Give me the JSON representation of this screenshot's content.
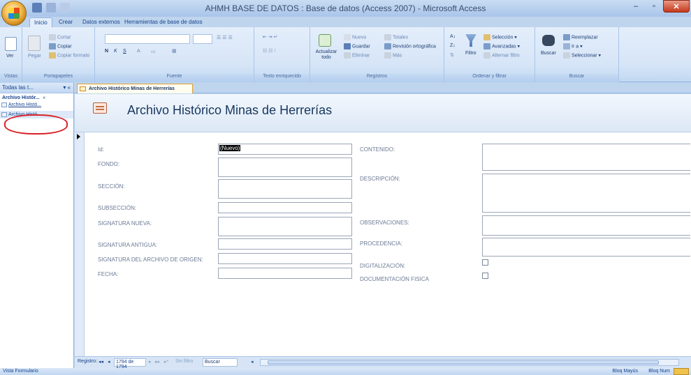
{
  "window": {
    "title": "AHMH BASE DE DATOS : Base de datos (Access 2007) - Microsoft Access",
    "min": "–",
    "max": "▫",
    "close": "✕"
  },
  "ribbon_tabs": [
    "Inicio",
    "Crear",
    "Datos externos",
    "Herramientas de base de datos"
  ],
  "ribbon": {
    "views": {
      "label": "Vistas",
      "ver": "Ver"
    },
    "clipboard": {
      "label": "Portapapeles",
      "pegar": "Pegar",
      "cortar": "Cortar",
      "copiar": "Copiar",
      "copiar_formato": "Copiar formato"
    },
    "font": {
      "label": "Fuente",
      "bold": "N",
      "italic": "K",
      "underline": "S",
      "color": "A"
    },
    "rich_text": {
      "label": "Texto enriquecido"
    },
    "records": {
      "label": "Registros",
      "actualizar": "Actualizar todo",
      "nuevo": "Nuevo",
      "guardar": "Guardar",
      "eliminar": "Eliminar",
      "totales": "Totales",
      "revision": "Revisión ortográfica",
      "mas": "Más"
    },
    "sort": {
      "label": "Ordenar y filtrar",
      "filtro": "Filtro",
      "seleccion": "Selección",
      "avanzadas": "Avanzadas",
      "alternar": "Alternar filtro"
    },
    "find": {
      "label": "Buscar",
      "buscar": "Buscar",
      "reemplazar": "Reemplazar",
      "ir_a": "Ir a",
      "seleccionar": "Seleccionar"
    }
  },
  "nav": {
    "header": "Todas las t...",
    "header_controls": "▾ «",
    "group": "Archivo Histór...",
    "group_control": "«",
    "items": [
      "Archivo Histó...",
      "Archivo Histó..."
    ]
  },
  "doc_tab": "Archivo Histórico Minas de Herrerías",
  "form": {
    "title": "Archivo Histórico Minas de Herrerías",
    "id_value": "(Nuevo)",
    "labels_left": {
      "id": "Id:",
      "fondo": "FONDO:",
      "seccion": "SECCIÓN:",
      "subseccion": "SUBSECCIÓN:",
      "signatura_nueva": "SIGNATURA NUEVA:",
      "signatura_antigua": "SIGNATURA ANTIGUA:",
      "signatura_origen": "SIGNATURA DEL ARCHIVO DE ORIGEN:",
      "fecha": "FECHA:"
    },
    "labels_right": {
      "contenido": "CONTENIDO:",
      "descripcion": "DESCRIPCIÓN:",
      "observaciones": "OBSERVACIONES:",
      "procedencia": "PROCEDENCIA:",
      "digitalizacion": "DIGITALIZACIÓN:",
      "documentacion_fisica": "DOCUMENTACIÓN FISICA"
    }
  },
  "record_nav": {
    "label": "Registro:",
    "first": "◂◂",
    "prev": "◂",
    "current": "1794 de 1794",
    "next": "▸",
    "last": "▸▸",
    "new": "▸*",
    "filter": "Sin filtro",
    "search": "Buscar"
  },
  "status": {
    "left": "Vista Formulario",
    "caps": "Bloq Mayús",
    "num": "Bloq Num"
  }
}
